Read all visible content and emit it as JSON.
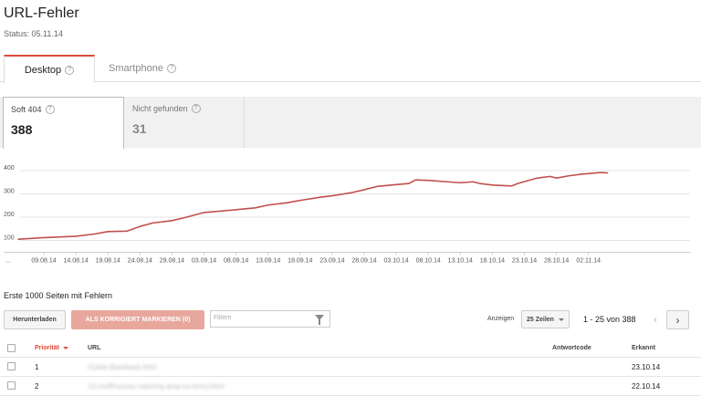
{
  "page": {
    "title": "URL-Fehler",
    "status": "Status: 05.11.14"
  },
  "tabs": [
    {
      "label": "Desktop",
      "active": true
    },
    {
      "label": "Smartphone",
      "active": false
    }
  ],
  "help_icon_glyph": "?",
  "metrics": [
    {
      "label": "Soft 404",
      "value": "388",
      "active": true
    },
    {
      "label": "Nicht gefunden",
      "value": "31",
      "active": false
    }
  ],
  "chart_data": {
    "type": "line",
    "y_ticks": [
      "400",
      "300",
      "200",
      "100"
    ],
    "ylim": [
      0,
      400
    ],
    "x_ticks": [
      "09.08.14",
      "14.08.14",
      "19.08.14",
      "24.08.14",
      "29.08.14",
      "03.09.14",
      "08.09.14",
      "13.09.14",
      "18.09.14",
      "23.09.14",
      "28.09.14",
      "03.10.14",
      "08.10.14",
      "13.10.14",
      "18.10.14",
      "23.10.14",
      "28.10.14",
      "02.11.14"
    ],
    "x_start_label": "...",
    "grid": true,
    "line_color": "#c0504d",
    "x": [
      "05.08.14",
      "09.08.14",
      "14.08.14",
      "17.08.14",
      "19.08.14",
      "22.08.14",
      "24.08.14",
      "26.08.14",
      "29.08.14",
      "31.08.14",
      "03.09.14",
      "08.09.14",
      "11.09.14",
      "13.09.14",
      "16.09.14",
      "18.09.14",
      "21.09.14",
      "23.09.14",
      "26.09.14",
      "28.09.14",
      "30.09.14",
      "03.10.14",
      "05.10.14",
      "06.10.14",
      "08.10.14",
      "11.10.14",
      "13.10.14",
      "15.10.14",
      "16.10.14",
      "18.10.14",
      "21.10.14",
      "22.10.14",
      "25.10.14",
      "27.10.14",
      "28.10.14",
      "30.10.14",
      "01.11.14",
      "04.11.14",
      "05.11.14"
    ],
    "values": [
      105,
      112,
      118,
      128,
      138,
      140,
      160,
      175,
      185,
      198,
      220,
      232,
      240,
      252,
      262,
      272,
      285,
      292,
      305,
      318,
      332,
      340,
      345,
      360,
      358,
      352,
      348,
      352,
      345,
      338,
      334,
      345,
      368,
      375,
      368,
      378,
      385,
      392,
      390
    ]
  },
  "list": {
    "title": "Erste 1000 Seiten mit Fehlern",
    "download_label": "Herunterladen",
    "mark_fixed_label": "ALS KORRIGIERT MARKIEREN (0)",
    "filter_placeholder": "Filtern",
    "show_label": "Anzeigen",
    "rows_per_page": "25 Zeilen",
    "pager_text": "1 - 25 von 388",
    "prev_glyph": "‹",
    "next_glyph": "›",
    "columns": {
      "priority": "Priorität",
      "url": "URL",
      "code": "Antwortcode",
      "detected": "Erkannt"
    },
    "rows": [
      {
        "priority": "1",
        "url": "/Garte-Bandasia.html",
        "code": "",
        "detected": "23.10.14"
      },
      {
        "priority": "2",
        "url": "/11-hoffhouses-catering-amp-ss-entry.html",
        "code": "",
        "detected": "22.10.14"
      }
    ]
  }
}
